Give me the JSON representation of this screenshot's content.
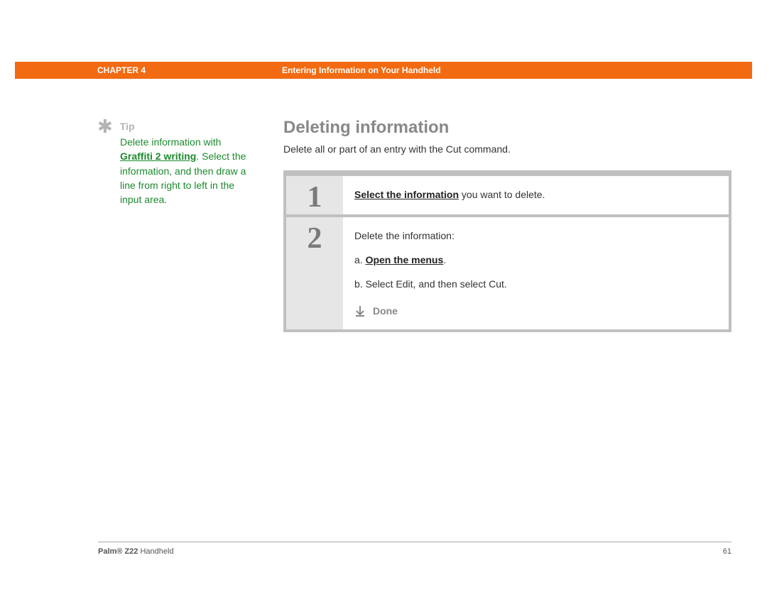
{
  "header": {
    "chapter": "CHAPTER 4",
    "section": "Entering Information on Your Handheld"
  },
  "sidebar": {
    "tip_label": "Tip",
    "tip_prefix": "Delete information with ",
    "tip_link": "Graffiti 2 writing",
    "tip_suffix": ". Select the information, and then draw a line from right to left in the input area."
  },
  "main": {
    "title": "Deleting information",
    "intro": "Delete all or part of an entry with the Cut command.",
    "steps": [
      {
        "num": "1",
        "link": "Select the information",
        "after_link": " you want to delete."
      },
      {
        "num": "2",
        "line1": "Delete the information:",
        "sub_a_prefix": "a.  ",
        "sub_a_link": "Open the menus",
        "sub_a_suffix": ".",
        "sub_b": "b.  Select Edit, and then select Cut.",
        "done": "Done"
      }
    ]
  },
  "footer": {
    "brand_bold": "Palm® Z22",
    "brand_rest": " Handheld",
    "page": "61"
  }
}
